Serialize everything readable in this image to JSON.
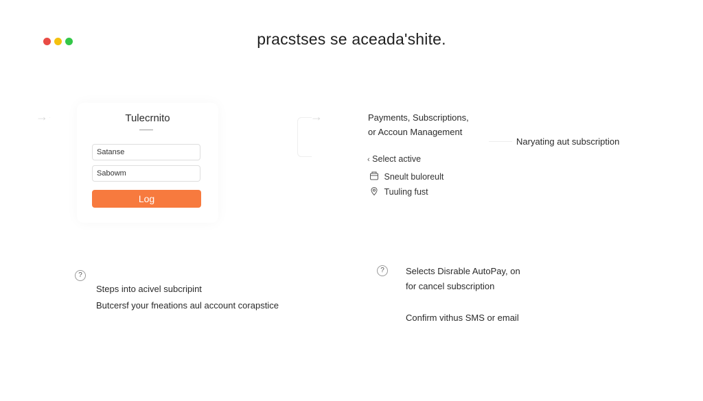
{
  "window": {
    "controls": [
      {
        "name": "close",
        "color": "#e94b45"
      },
      {
        "name": "minimize",
        "color": "#f4c10f"
      },
      {
        "name": "maximize",
        "color": "#33c748"
      }
    ]
  },
  "page_title": "pracstses se aceada'shite.",
  "login": {
    "title": "Tulecrnito",
    "username_value": "Satanse",
    "password_value": "Sabowm",
    "button_label": "Log",
    "button_color": "#f77a3e"
  },
  "menu": {
    "heading_line1": "Payments, Subscriptions,",
    "heading_line2": "or Accoun Management",
    "select_active": "Select active",
    "item1": "Sneult buloreult",
    "item2": "Tuuling fust",
    "icons": [
      "card-icon",
      "location-pin-icon"
    ]
  },
  "side_note": "Naryating aut subscription",
  "help_left": {
    "icon": "?",
    "line1": "Steps into acivel subcripint",
    "line2": "Butcersf your fneations aul account corapstice"
  },
  "help_right": {
    "icon": "?",
    "line1": "Selects Disrable AutoPay, on",
    "line2": "for cancel subscription",
    "line3": "Confirm vithus SMS or email"
  }
}
